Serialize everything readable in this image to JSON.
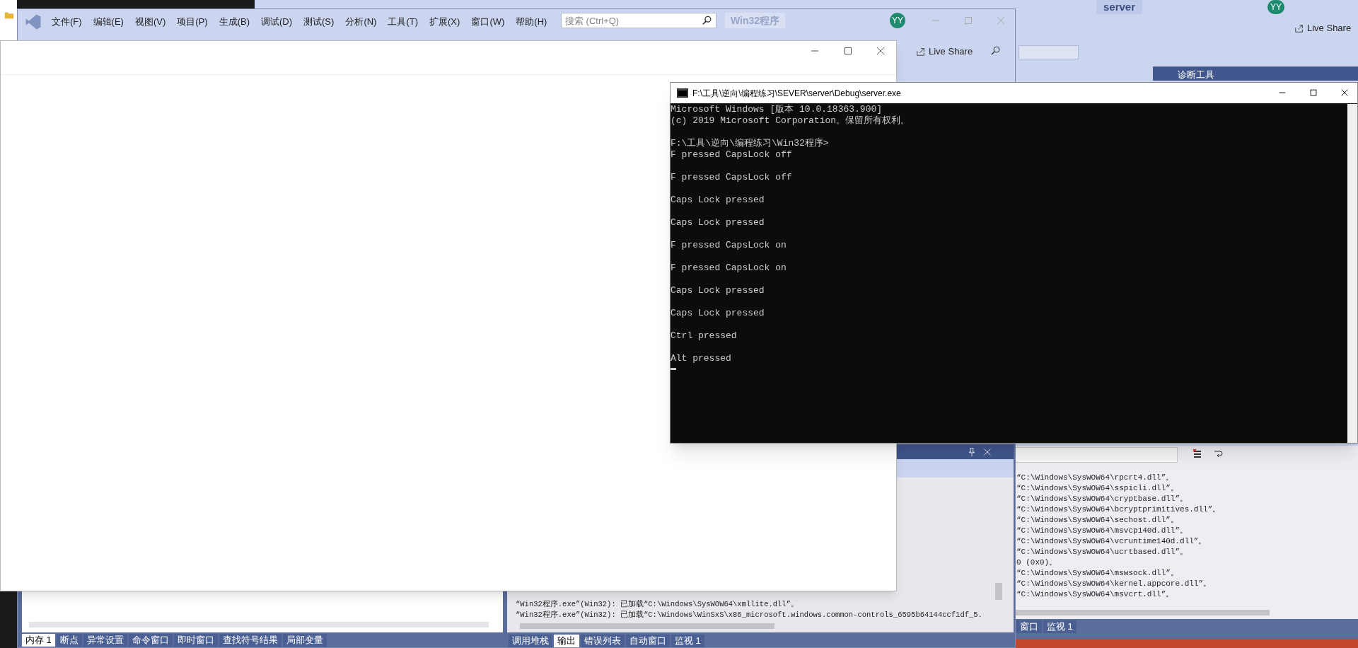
{
  "back_ide": {
    "project": "server",
    "avatar": "YY",
    "live_share": "Live Share",
    "diagnostics_title": "诊断工具",
    "output_lines": [
      "“C:\\Windows\\SysWOW64\\rpcrt4.dll”。",
      "“C:\\Windows\\SysWOW64\\sspicli.dll”。",
      "“C:\\Windows\\SysWOW64\\cryptbase.dll”。",
      "“C:\\Windows\\SysWOW64\\bcryptprimitives.dll”。",
      "“C:\\Windows\\SysWOW64\\sechost.dll”。",
      "“C:\\Windows\\SysWOW64\\msvcp140d.dll”。",
      "“C:\\Windows\\SysWOW64\\vcruntime140d.dll”。",
      "“C:\\Windows\\SysWOW64\\ucrtbased.dll”。",
      "0 (0x0)。",
      "“C:\\Windows\\SysWOW64\\mswsock.dll”。",
      "“C:\\Windows\\SysWOW64\\kernel.appcore.dll”。",
      "“C:\\Windows\\SysWOW64\\msvcrt.dll”。"
    ],
    "tabs": [
      {
        "label": "窗口",
        "selected": false
      },
      {
        "label": "监视 1",
        "selected": false
      }
    ]
  },
  "ide": {
    "menu": [
      "文件(F)",
      "编辑(E)",
      "视图(V)",
      "项目(P)",
      "生成(B)",
      "调试(D)",
      "测试(S)",
      "分析(N)",
      "工具(T)",
      "扩展(X)",
      "窗口(W)",
      "帮助(H)"
    ],
    "search_placeholder": "搜索 (Ctrl+Q)",
    "title": "Win32程序",
    "avatar": "YY",
    "live_share": "Live Share",
    "output_lines": [
      "“Win32程序.exe”(Win32): 已加载“C:\\Windows\\SysWOW64\\xmllite.dll”。",
      "“Win32程序.exe”(Win32): 已加载“C:\\Windows\\WinSxS\\x86_microsoft.windows.common-controls_6595b64144ccf1df_5."
    ],
    "left_tabs": [
      {
        "label": "内存 1",
        "selected": true
      },
      {
        "label": "断点",
        "selected": false
      },
      {
        "label": "异常设置",
        "selected": false
      },
      {
        "label": "命令窗口",
        "selected": false
      },
      {
        "label": "即时窗口",
        "selected": false
      },
      {
        "label": "查找符号结果",
        "selected": false
      },
      {
        "label": "局部变量",
        "selected": false
      }
    ],
    "right_tabs": [
      {
        "label": "调用堆栈",
        "selected": false
      },
      {
        "label": "输出",
        "selected": true
      },
      {
        "label": "错误列表",
        "selected": false
      },
      {
        "label": "自动窗口",
        "selected": false
      },
      {
        "label": "监视 1",
        "selected": false
      }
    ]
  },
  "console": {
    "title": "F:\\工具\\逆向\\编程练习\\SEVER\\server\\Debug\\server.exe",
    "header": [
      "Microsoft Windows [版本 10.0.18363.900]",
      "(c) 2019 Microsoft Corporation。保留所有权利。"
    ],
    "prompt": "F:\\工具\\逆向\\编程练习\\Win32程序>",
    "outputs": [
      "F pressed CapsLock off",
      "F pressed CapsLock off",
      "Caps Lock pressed",
      "Caps Lock pressed",
      "F pressed CapsLock on",
      "F pressed CapsLock on",
      "Caps Lock pressed",
      "Caps Lock pressed",
      "Ctrl pressed",
      "Alt pressed"
    ]
  }
}
